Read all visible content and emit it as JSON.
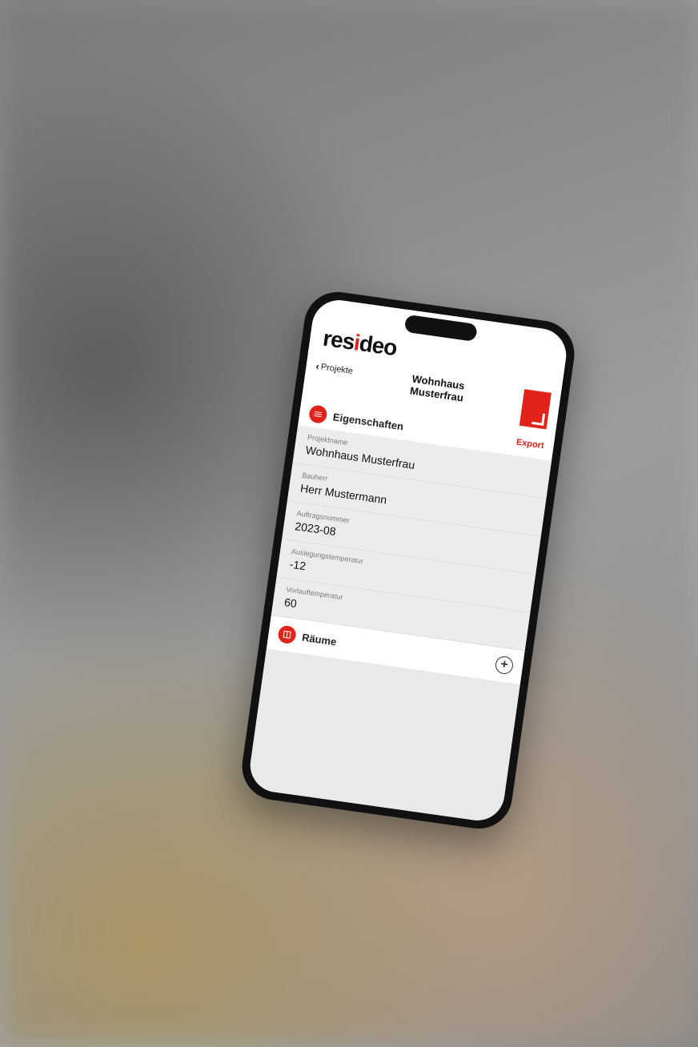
{
  "brand": "resideo",
  "nav": {
    "back_label": "Projekte",
    "title_line1": "Wohnhaus",
    "title_line2": "Musterfrau"
  },
  "section_properties": {
    "title": "Eigenschaften",
    "export_label": "Export"
  },
  "fields": {
    "project_name": {
      "label": "Projektname",
      "value": "Wohnhaus Musterfrau"
    },
    "client": {
      "label": "Bauherr",
      "value": "Herr Mustermann"
    },
    "order_number": {
      "label": "Auftragsnummer",
      "value": "2023-08"
    },
    "design_temp": {
      "label": "Auslegungstemperatur",
      "value": "-12"
    },
    "flow_temp": {
      "label": "Vorlauftemperatur",
      "value": "60"
    }
  },
  "section_rooms": {
    "title": "Räume"
  }
}
